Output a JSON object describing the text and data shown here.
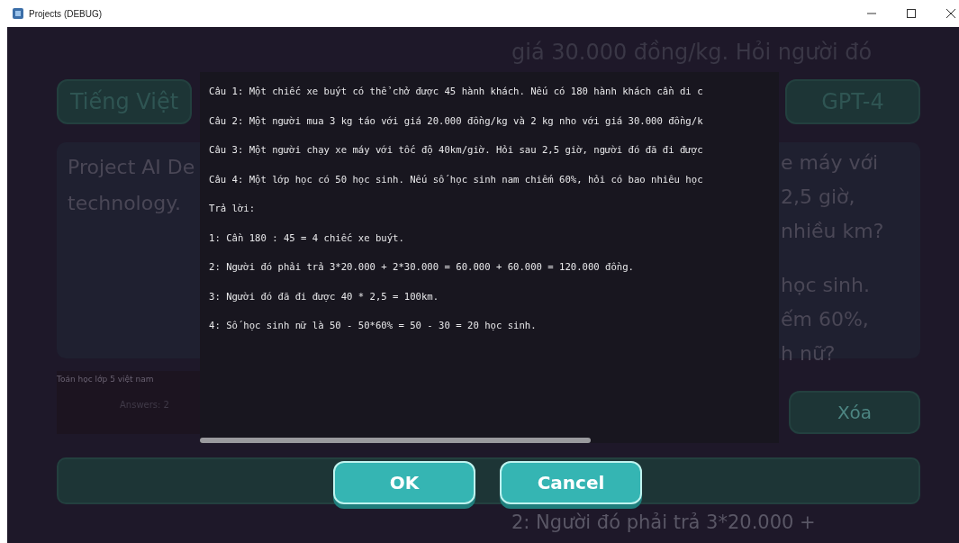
{
  "window": {
    "title": "Projects (DEBUG)"
  },
  "background": {
    "top_text": "giá 30.000 đồng/kg. Hỏi người đó",
    "language_button": "Tiếng Việt",
    "model_button": "GPT-4",
    "project_card": [
      "Project AI De",
      "technology."
    ],
    "question_card": [
      [
        "e máy với",
        "2,5 giờ,",
        "nhiều km?"
      ],
      [
        "học sinh.",
        "ếm 60%,",
        "h nữ?"
      ]
    ],
    "project_name": "Toán học lớp 5 việt nam",
    "stats": [
      "Answers: 2"
    ],
    "delete_button": "Xóa",
    "bottom_text": "2: Người đó phải trả 3*20.000 +"
  },
  "dialog": {
    "lines": [
      "Câu 1: Một chiếc xe buýt có thể chở được 45 hành khách. Nếu có 180 hành khách cần di c",
      "Câu 2: Một người mua 3 kg táo với giá 20.000 đồng/kg và 2 kg nho với giá 30.000 đồng/k",
      "Câu 3: Một người chạy xe máy với tốc độ 40km/giờ. Hỏi sau 2,5 giờ, người đó đã đi được",
      "Câu 4: Một lớp học có 50 học sinh. Nếu số học sinh nam chiếm 60%, hỏi có bao nhiêu học",
      "Trả lời:",
      "1: Cần 180 : 45 = 4 chiếc xe buýt.",
      "2: Người đó phải trả 3*20.000 + 2*30.000 = 60.000 + 60.000 = 120.000 đồng.",
      "3: Người đó đã đi được 40 * 2,5 = 100km.",
      "4: Số học sinh nữ là 50 - 50*60% = 50 - 30 = 20 học sinh."
    ],
    "buttons": [
      "OK",
      "Cancel"
    ]
  }
}
